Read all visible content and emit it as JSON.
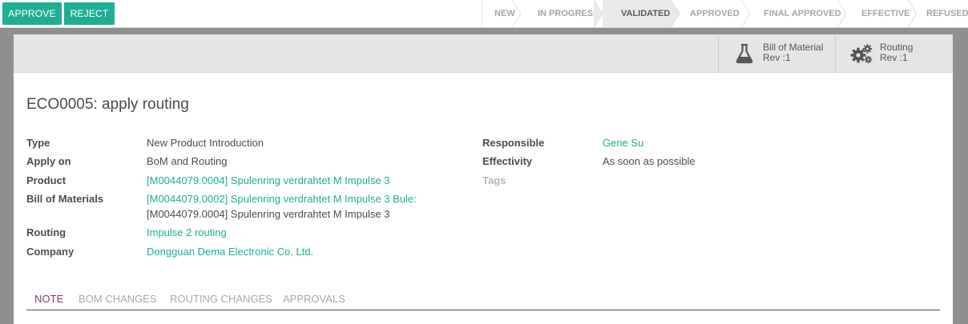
{
  "actions": {
    "approve": "APPROVE",
    "reject": "REJECT"
  },
  "stages": [
    {
      "label": "NEW",
      "active": false
    },
    {
      "label": "IN PROGRESS",
      "active": false
    },
    {
      "label": "VALIDATED",
      "active": true
    },
    {
      "label": "APPROVED",
      "active": false
    },
    {
      "label": "FINAL APPROVED",
      "active": false
    },
    {
      "label": "EFFECTIVE",
      "active": false
    },
    {
      "label": "REFUSED",
      "active": false
    }
  ],
  "smart_buttons": {
    "bom": {
      "title": "Bill of Material",
      "sub": "Rev :1",
      "icon": "flask-icon"
    },
    "routing": {
      "title": "Routing",
      "sub": "Rev :1",
      "icon": "gears-icon"
    }
  },
  "record": {
    "title": "ECO0005: apply routing",
    "left_fields": {
      "type": {
        "label": "Type",
        "value": "New Product Introduction"
      },
      "apply_on": {
        "label": "Apply on",
        "value": "BoM and Routing"
      },
      "product": {
        "label": "Product",
        "value": "[M0044079.0004] Spulenring verdrahtet M Impulse 3"
      },
      "bom": {
        "label": "Bill of Materials",
        "value_line1": "[M0044079.0002] Spulenring verdrahtet M Impulse 3 Bule:",
        "value_line2": "[M0044079.0004] Spulenring verdrahtet M Impulse 3"
      },
      "routing": {
        "label": "Routing",
        "value": "Impulse 2 routing"
      },
      "company": {
        "label": "Company",
        "value": "Dongguan Dema Electronic Co. Ltd."
      }
    },
    "right_fields": {
      "responsible": {
        "label": "Responsible",
        "value": "Gene Su"
      },
      "effectivity": {
        "label": "Effectivity",
        "value": "As soon as possible"
      },
      "tags": {
        "label": "Tags"
      }
    }
  },
  "tabs": [
    {
      "label": "NOTE",
      "active": true
    },
    {
      "label": "BOM CHANGES",
      "active": false
    },
    {
      "label": "ROUTING CHANGES",
      "active": false
    },
    {
      "label": "APPROVALS",
      "active": false
    }
  ],
  "colors": {
    "accent": "#1fae94",
    "active_tab": "#7c3f6e",
    "active_stage_bg": "#e9e9e9",
    "backdrop": "#8f8f8f"
  }
}
